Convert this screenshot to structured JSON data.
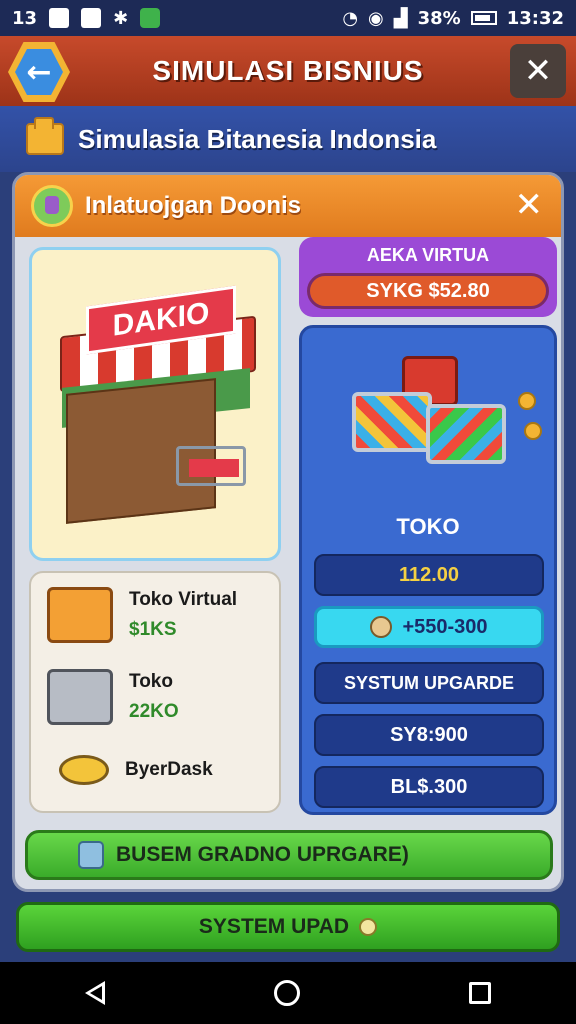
{
  "status_bar": {
    "left_text": "13",
    "battery": "38%",
    "time": "13:32"
  },
  "header": {
    "title": "SIMULASI BISNIUS",
    "back_icon": "arrow-left-icon",
    "close_icon": "close-icon"
  },
  "subheader": {
    "title": "Simulasia Bitanesia Indonsia",
    "icon": "folder-icon"
  },
  "panel": {
    "title": "Inlatuojgan Doonis",
    "close_label": "✕",
    "shop_sign": "DAKIO",
    "items": [
      {
        "name": "Toko Virtual",
        "price": "$1KS",
        "icon": "box-icon"
      },
      {
        "name": "Toko",
        "price": "22KO",
        "icon": "machine-icon"
      },
      {
        "name": "ByerDask",
        "price": "",
        "icon": "magnifier-icon"
      }
    ],
    "virtual": {
      "label": "AEKA VIRTUA",
      "price": "SYKG $52.80"
    },
    "store": {
      "title": "TOKO",
      "value": "112.00",
      "coin_amount": "+550-300",
      "system_upgrade": "SYSTUM UPGARDE",
      "price_a": "SY8:900",
      "price_b": "BL$.300"
    },
    "green_button": "BUSEM GRADNO UPRGARE)"
  },
  "system_button": "SYSTEM UPAD",
  "colors": {
    "header_red": "#c74a2b",
    "panel_orange": "#f59a36",
    "store_blue": "#3a6ad0",
    "virtual_purple": "#9b4ad6",
    "button_green": "#3aac2a",
    "cyan_pill": "#38d8f0"
  }
}
